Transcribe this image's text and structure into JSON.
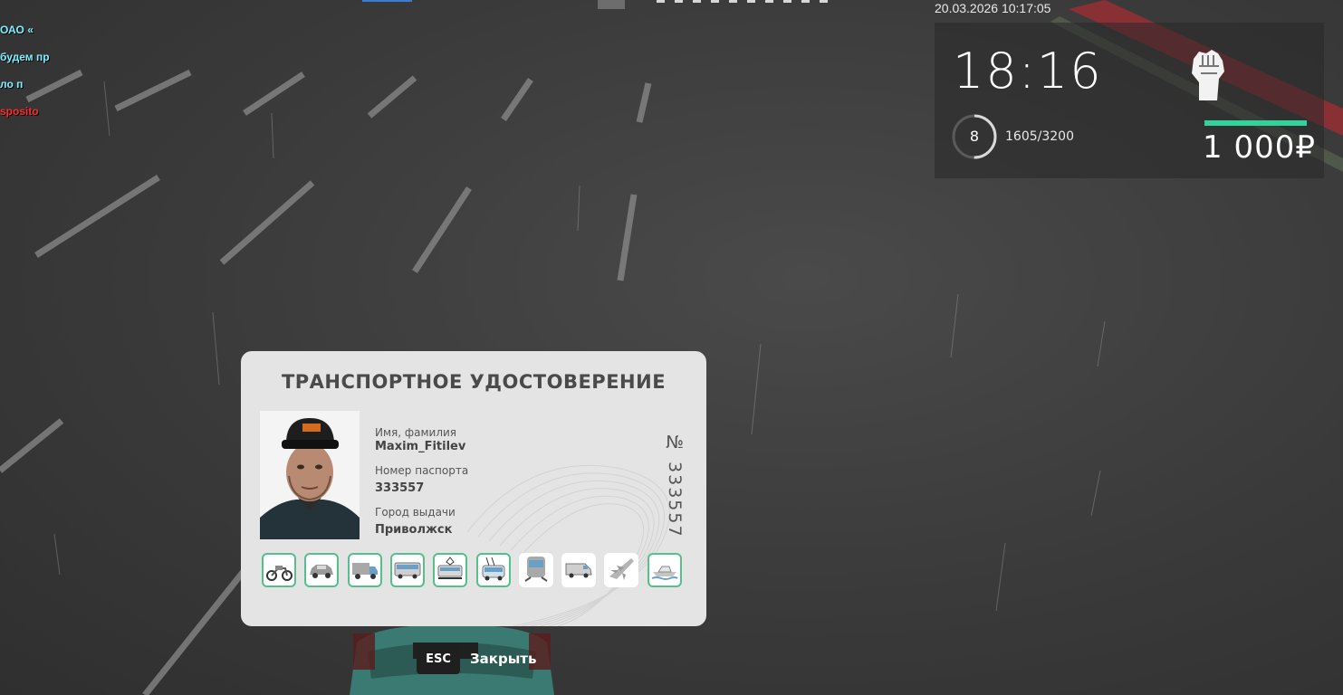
{
  "chat": [
    {
      "text": "ОАО «",
      "color": "#7df0ff"
    },
    {
      "text": "будем пр",
      "color": "#7df0ff"
    },
    {
      "text": "ло п",
      "color": "#7df0ff"
    },
    {
      "text": "sposito",
      "color": "#ff2a2a"
    }
  ],
  "hud": {
    "datetime": "20.03.2026 10:17:05",
    "clock": "18:16",
    "level": "8",
    "exp": "1605/3200",
    "exp_progress": 0.5016,
    "money": "1 000₽",
    "money_bar_color": "#2fd39b",
    "icon": "raised-fist-icon"
  },
  "card": {
    "title": "ТРАНСПОРТНОЕ УДОСТОВЕРЕНИЕ",
    "number": "№ 333557",
    "fields": [
      {
        "label": "Имя, фамилия",
        "value": "Maxim_Fitilev"
      },
      {
        "label": "Номер паспорта",
        "value": "333557"
      },
      {
        "label": "Город выдачи",
        "value": "Приволжск"
      }
    ],
    "accent_color": "#55c089",
    "categories": [
      {
        "name": "motorcycle-icon",
        "active": true
      },
      {
        "name": "car-icon",
        "active": true
      },
      {
        "name": "truck-icon",
        "active": true
      },
      {
        "name": "bus-icon",
        "active": true
      },
      {
        "name": "tram-icon",
        "active": true
      },
      {
        "name": "trolleybus-icon",
        "active": true
      },
      {
        "name": "metro-train-icon",
        "active": false
      },
      {
        "name": "van-icon",
        "active": false
      },
      {
        "name": "airplane-icon",
        "active": false
      },
      {
        "name": "boat-icon",
        "active": true
      }
    ]
  },
  "close": {
    "key": "ESC",
    "label": "Закрыть"
  }
}
